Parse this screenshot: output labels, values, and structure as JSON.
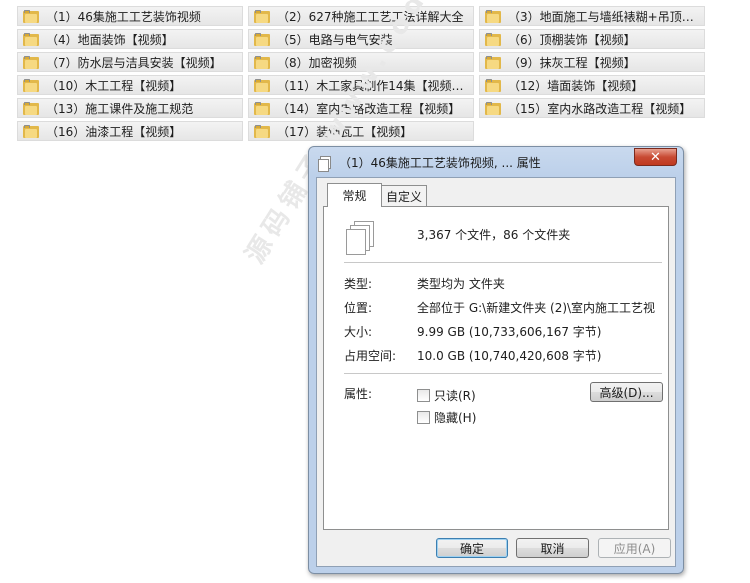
{
  "folders": [
    "（1）46集施工工艺装饰视频",
    "（2）627种施工工艺工法详解大全",
    "（3）地面施工与墙纸裱糊+吊顶工...",
    "（4）地面装饰【视频】",
    "（5）电路与电气安装",
    "（6）顶棚装饰【视频】",
    "（7）防水层与洁具安装【视频】",
    "（8）加密视频",
    "（9）抹灰工程【视频】",
    "（10）木工工程【视频】",
    "（11）木工家具制作14集【视频】1...",
    "（12）墙面装饰【视频】",
    "（13）施工课件及施工规范",
    "（14）室内电路改造工程【视频】",
    "（15）室内水路改造工程【视频】",
    "（16）油漆工程【视频】",
    "（17）装饰瓦工【视频】"
  ],
  "watermark": "源码铺子 www.code...",
  "dialog": {
    "title": "（1）46集施工工艺装饰视频, ... 属性",
    "close_glyph": "✕",
    "tabs": [
      "常规",
      "自定义"
    ],
    "summary": "3,367 个文件，86 个文件夹",
    "props": {
      "type_label": "类型:",
      "type_value": "类型均为 文件夹",
      "location_label": "位置:",
      "location_value": "全部位于 G:\\新建文件夹 (2)\\室内施工工艺视",
      "size_label": "大小:",
      "size_value": "9.99 GB (10,733,606,167 字节)",
      "disk_label": "占用空间:",
      "disk_value": "10.0 GB (10,740,420,608 字节)",
      "attr_label": "属性:",
      "readonly_label": "只读(R)",
      "hidden_label": "隐藏(H)",
      "advanced_label": "高级(D)..."
    },
    "buttons": {
      "ok": "确定",
      "cancel": "取消",
      "apply": "应用(A)"
    }
  }
}
